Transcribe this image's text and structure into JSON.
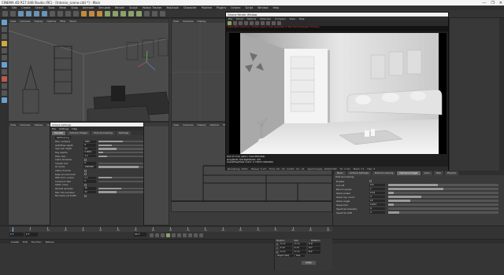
{
  "window": {
    "title": "CINEMA 4D R17.048 Studio (RC) - [Interior_scene.c4d *] - Main",
    "controls": [
      "—",
      "❐",
      "✕"
    ]
  },
  "menubar": [
    "File",
    "Edit",
    "Create",
    "Select",
    "Tools",
    "Mesh",
    "Snap",
    "Animate",
    "Simulate",
    "Render",
    "Sculpt",
    "Motion Tracker",
    "MoGraph",
    "Character",
    "Pipeline",
    "Plugins",
    "Octane",
    "Script",
    "Window",
    "Help"
  ],
  "viewport": {
    "label": "Perspective",
    "menu": [
      "View",
      "Cameras",
      "Display",
      "Options",
      "Filter",
      "Panel"
    ],
    "bottom_menu": [
      "View",
      "Cameras",
      "Display",
      "Options",
      "Filter",
      "Panel"
    ]
  },
  "picture_viewer": {
    "title": "Octane Render Window",
    "menu": [
      "File",
      "Cloud",
      "Options",
      "Materials",
      "Compare",
      "View",
      "Help"
    ],
    "info_line": "Total GPU memory / 6.0Gb  used 2.7Gb  Available 3.3Gb  Rendertarget: Primary",
    "stats": [
      "Out of core used / max:0Kb/4Gb",
      "Grey8/16: 0/0     Rgb32/64: 3/0",
      "Used/free/total vram: 2.7Gb/3.3Gb/6Gb"
    ],
    "status": [
      "Rendering: 100%",
      "Ms/sec: 5.23",
      "Time: 00 : 02 : 21/00 : 02 : 21",
      "Spp/maxspp: 1000/1000",
      "Tri: 2.4m",
      "Mesh: 71",
      "Hair: 0"
    ]
  },
  "render_dialog": {
    "title": "Octane Settings",
    "menu": [
      "File",
      "Settings",
      "Help"
    ],
    "tabs": [
      "Kernels",
      "Camera Imager",
      "Post processing",
      "Settings"
    ],
    "active_tab": "Kernels",
    "mode": "Pathtracing",
    "rows": [
      {
        "label": "Max. samples",
        "value": "1000",
        "fill": 0.55
      },
      {
        "label": "GI/Diffuse depth",
        "value": "8",
        "fill": 0.3
      },
      {
        "label": "Specular depth",
        "value": "24",
        "fill": 0.4
      },
      {
        "label": "Ray epsilon",
        "value": "0.0001",
        "fill": 0.1
      },
      {
        "label": "Filter size",
        "value": "1.2",
        "fill": 0.2
      },
      {
        "label": "Alpha shadows",
        "value": "",
        "fill": 0
      },
      {
        "label": "Caustic blur",
        "value": "0.",
        "fill": 0.0
      },
      {
        "label": "GI clamp",
        "value": "1000000",
        "fill": 0.9
      },
      {
        "label": "Alpha channel",
        "value": "",
        "fill": 0
      },
      {
        "label": "Keep environment",
        "value": "",
        "fill": 0
      },
      {
        "label": "Path term. power",
        "value": "0.3",
        "fill": 0.3
      },
      {
        "label": "Coherent ratio",
        "value": "0.",
        "fill": 0.0
      },
      {
        "label": "Static noise",
        "value": "",
        "fill": 0
      },
      {
        "label": "Parallel samples",
        "value": "16",
        "fill": 0.5
      },
      {
        "label": "Max. tile samples",
        "value": "32",
        "fill": 0.4
      },
      {
        "label": "Minimize net traffic",
        "value": "",
        "fill": 0
      }
    ]
  },
  "attributes": {
    "tabs": [
      "Basic",
      "Octane Settings",
      "Post processing",
      "Camera Imager",
      "Lens",
      "Hair",
      "Physics"
    ],
    "active_tab": "Camera Imager",
    "section": "Post processing",
    "rows": [
      {
        "label": "Enable",
        "value": "",
        "fill": 0
      },
      {
        "label": "Cut off",
        "value": "0.8",
        "fill": 0.45
      },
      {
        "label": "Bloom power",
        "value": "1.",
        "fill": 0.5
      },
      {
        "label": "Glare power",
        "value": "0.01",
        "fill": 0.05
      },
      {
        "label": "Glare ray count",
        "value": "3",
        "fill": 0.3
      },
      {
        "label": "Glare angle",
        "value": "15",
        "fill": 0.2
      },
      {
        "label": "Glare blur",
        "value": "0.001",
        "fill": 0.05
      },
      {
        "label": "Spectral intensity",
        "value": "0.",
        "fill": 0
      },
      {
        "label": "Spectral shift",
        "value": "2.",
        "fill": 0.1
      }
    ]
  },
  "timeline": {
    "frame_field": "0 F",
    "ticks": [
      "0",
      "5",
      "10",
      "15",
      "20",
      "25",
      "30",
      "35",
      "40",
      "45",
      "50",
      "55",
      "60",
      "65",
      "70",
      "75",
      "80",
      "85",
      "90"
    ],
    "current_frame": "0 F",
    "range_start": "0 F",
    "range_end": "90 F"
  },
  "materials": {
    "menu": [
      "Create",
      "Edit",
      "Function",
      "Texture"
    ]
  },
  "coordinates": {
    "header": [
      "Position",
      "Size",
      "Rotation"
    ],
    "rows": [
      {
        "axis": "X",
        "pos": "0 cm",
        "size": "0 cm",
        "rot": "H  0°"
      },
      {
        "axis": "Y",
        "pos": "0 cm",
        "size": "0 cm",
        "rot": "P  0°"
      },
      {
        "axis": "Z",
        "pos": "0 cm",
        "size": "0 cm",
        "rot": "B  0°"
      }
    ],
    "mode": "Object (Rel)",
    "size_mode": "Size",
    "apply_label": "Apply"
  },
  "colors": {
    "accent": "#6c93b8",
    "render_bg": "#000000",
    "warning": "#e04040"
  }
}
